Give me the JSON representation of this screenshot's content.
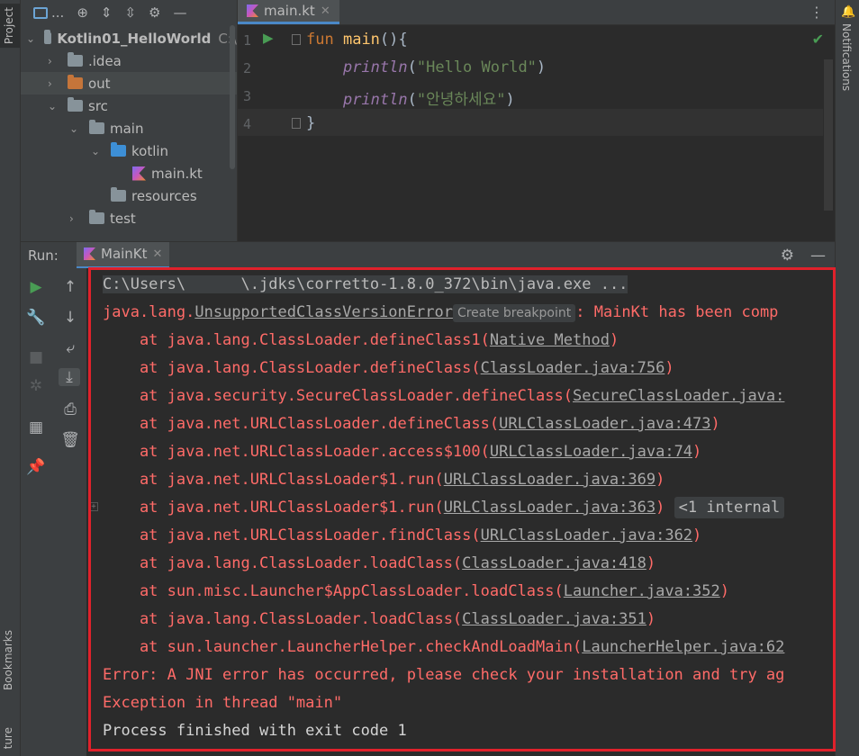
{
  "left_strip": {
    "project_tab": "Project",
    "bookmarks_tab": "Bookmarks",
    "structure_tab": "ture"
  },
  "right_strip": {
    "notifications_tab": "Notifications"
  },
  "project_toolbar": {
    "dropdown_label": "..."
  },
  "project_tree": [
    {
      "label": "Kotlin01_HelloWorld",
      "suffix": "C:\\",
      "type": "folder",
      "indent": 0,
      "expanded": true
    },
    {
      "label": ".idea",
      "type": "folder",
      "indent": 1,
      "expanded": false
    },
    {
      "label": "out",
      "type": "folder-orange",
      "indent": 1,
      "expanded": false,
      "selected": true
    },
    {
      "label": "src",
      "type": "folder",
      "indent": 1,
      "expanded": true
    },
    {
      "label": "main",
      "type": "folder",
      "indent": 2,
      "expanded": true
    },
    {
      "label": "kotlin",
      "type": "folder-blue",
      "indent": 3,
      "expanded": true
    },
    {
      "label": "main.kt",
      "type": "kotlin-file",
      "indent": 4
    },
    {
      "label": "resources",
      "type": "folder",
      "indent": 3
    },
    {
      "label": "test",
      "type": "folder",
      "indent": 2,
      "expanded": false
    }
  ],
  "editor": {
    "tab_label": "main.kt",
    "line_numbers": [
      "1",
      "2",
      "3",
      "4"
    ],
    "code": {
      "l1_kw": "fun",
      "l1_name": "main",
      "l1_rest": "(){",
      "l2_call": "println",
      "l2_open": "(",
      "l2_str": "\"Hello World\"",
      "l2_close": ")",
      "l3_call": "println",
      "l3_open": "(",
      "l3_str": "\"안녕하세요\"",
      "l3_close": ")",
      "l4": "}"
    }
  },
  "run_panel": {
    "label": "Run:",
    "tab_label": "MainKt",
    "console": {
      "cmd_pre": "C:\\Users\\",
      "cmd_post": "\\.jdks\\corretto-1.8.0_372\\bin\\java.exe ...",
      "err_pre": "java.lang.",
      "err_link": "UnsupportedClassVersionError",
      "err_chip": "Create breakpoint",
      "err_post": ": MainKt has been comp",
      "stack": [
        {
          "text": "    at java.lang.ClassLoader.defineClass1(",
          "link": "Native Method",
          "end": ")"
        },
        {
          "text": "    at java.lang.ClassLoader.defineClass(",
          "link": "ClassLoader.java:756",
          "end": ")"
        },
        {
          "text": "    at java.security.SecureClassLoader.defineClass(",
          "link": "SecureClassLoader.java:",
          "end": ""
        },
        {
          "text": "    at java.net.URLClassLoader.defineClass(",
          "link": "URLClassLoader.java:473",
          "end": ")"
        },
        {
          "text": "    at java.net.URLClassLoader.access$100(",
          "link": "URLClassLoader.java:74",
          "end": ")"
        },
        {
          "text": "    at java.net.URLClassLoader$1.run(",
          "link": "URLClassLoader.java:369",
          "end": ")"
        },
        {
          "text": "    at java.net.URLClassLoader$1.run(",
          "link": "URLClassLoader.java:363",
          "end": ")",
          "chip": "<1 internal"
        },
        {
          "text": "    at java.net.URLClassLoader.findClass(",
          "link": "URLClassLoader.java:362",
          "end": ")"
        },
        {
          "text": "    at java.lang.ClassLoader.loadClass(",
          "link": "ClassLoader.java:418",
          "end": ")"
        },
        {
          "text": "    at sun.misc.Launcher$AppClassLoader.loadClass(",
          "link": "Launcher.java:352",
          "end": ")"
        },
        {
          "text": "    at java.lang.ClassLoader.loadClass(",
          "link": "ClassLoader.java:351",
          "end": ")"
        },
        {
          "text": "    at sun.launcher.LauncherHelper.checkAndLoadMain(",
          "link": "LauncherHelper.java:62",
          "end": ""
        }
      ],
      "jni_error": "Error: A JNI error has occurred, please check your installation and try ag",
      "exception": "Exception in thread \"main\"",
      "finished": "Process finished with exit code 1"
    }
  },
  "colors": {
    "highlight_frame": "#e0212b",
    "accent": "#4a88c7",
    "run_green": "#499c54",
    "error_red": "#ff6b68"
  }
}
